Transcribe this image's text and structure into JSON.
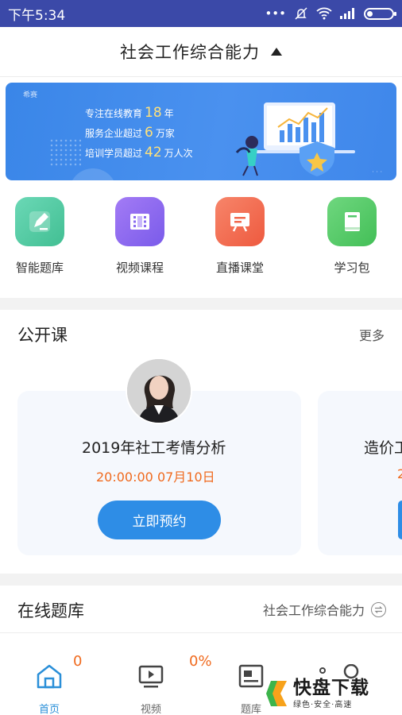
{
  "status_bar": {
    "time": "下午5:34"
  },
  "header": {
    "title": "社会工作综合能力"
  },
  "banner": {
    "logo_text": "希赛",
    "line1": {
      "prefix": "专注在线教育",
      "number": "18",
      "suffix": "年"
    },
    "line2": {
      "prefix": "服务企业超过",
      "number": "6",
      "suffix": "万家"
    },
    "line3": {
      "prefix": "培训学员超过",
      "number": "42",
      "suffix": "万人次"
    }
  },
  "quick_menu": [
    {
      "label": "智能题库",
      "icon": "pencil-icon",
      "color": "#53c9a3"
    },
    {
      "label": "视频课程",
      "icon": "film-icon",
      "color": "#8a6cf0"
    },
    {
      "label": "直播课堂",
      "icon": "live-board-icon",
      "color": "#f26a4f"
    },
    {
      "label": "学习包",
      "icon": "book-icon",
      "color": "#52c86a"
    }
  ],
  "public_course": {
    "title": "公开课",
    "more": "更多",
    "cards": [
      {
        "title": "2019年社工考情分析",
        "time": "20:00:00  07月10日",
        "button": "立即预约"
      },
      {
        "title": "造价工",
        "time": "2"
      }
    ]
  },
  "question_bank": {
    "title": "在线题库",
    "subject": "社会工作综合能力",
    "partial_values": [
      "0",
      "0%"
    ]
  },
  "bottom_nav": [
    {
      "label": "首页",
      "icon": "home-icon",
      "active": true
    },
    {
      "label": "视频",
      "icon": "video-icon",
      "active": false
    },
    {
      "label": "题库",
      "icon": "question-bank-icon",
      "active": false
    }
  ],
  "watermark": {
    "main": "快盘下载",
    "sub": "绿色·安全·高速"
  },
  "colors": {
    "status_bar": "#3b49a8",
    "accent_blue": "#2e8de6",
    "accent_orange": "#f06a1e",
    "nav_active": "#2a8fd8"
  }
}
